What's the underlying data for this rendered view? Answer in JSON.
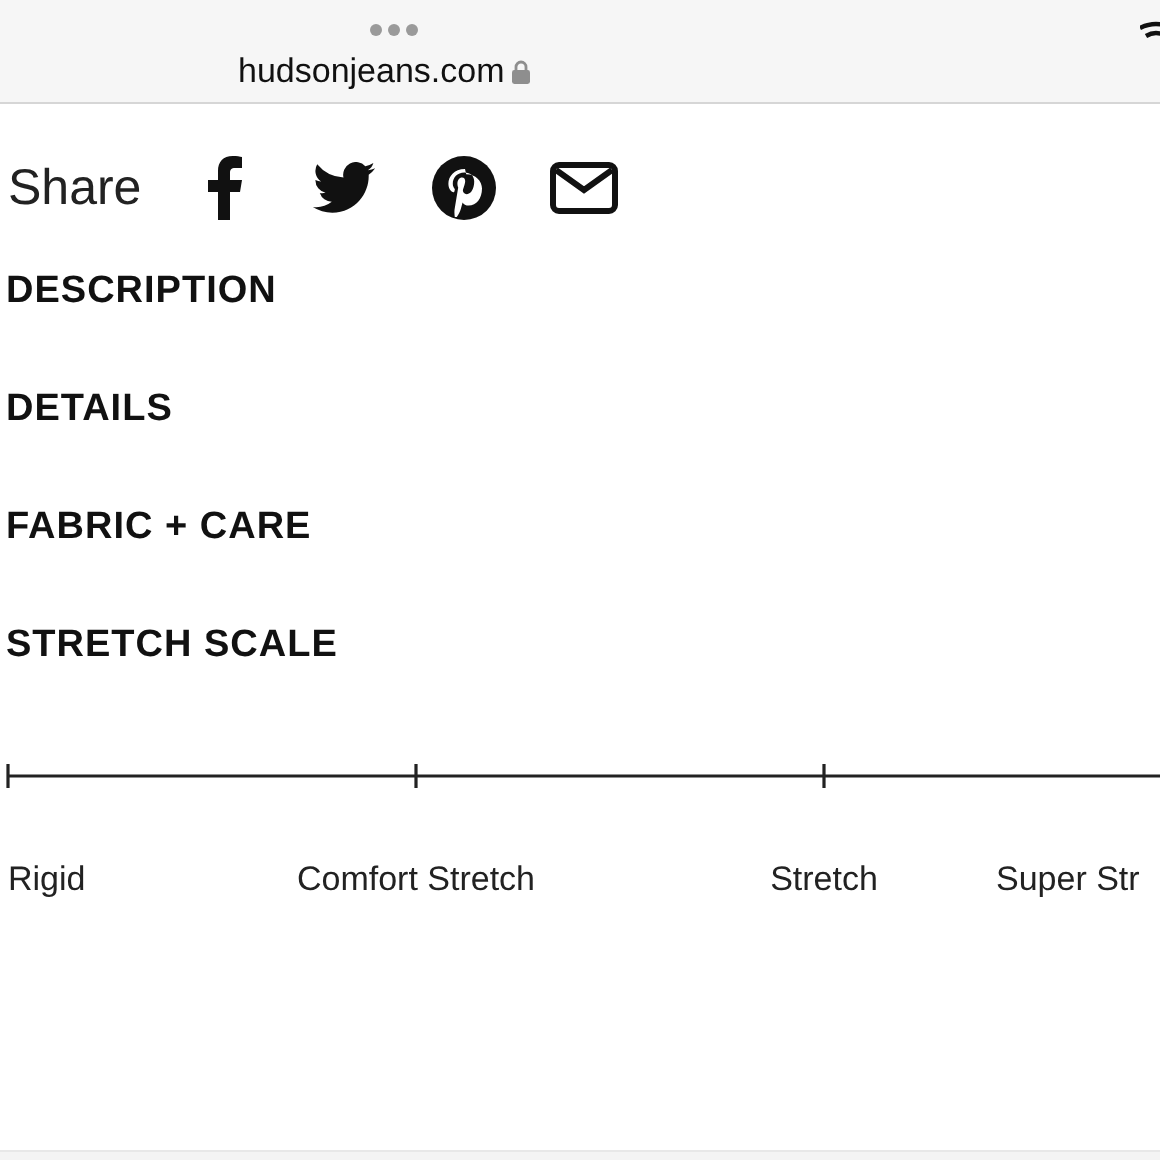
{
  "browser": {
    "url": "hudsonjeans.com"
  },
  "share": {
    "label": "Share"
  },
  "sections": [
    {
      "title": "DESCRIPTION"
    },
    {
      "title": "DETAILS"
    },
    {
      "title": "FABRIC + CARE"
    },
    {
      "title": "STRETCH SCALE"
    }
  ],
  "stretch_scale": {
    "labels": [
      "Rigid",
      "Comfort Stretch",
      "Stretch",
      "Super Str"
    ]
  }
}
